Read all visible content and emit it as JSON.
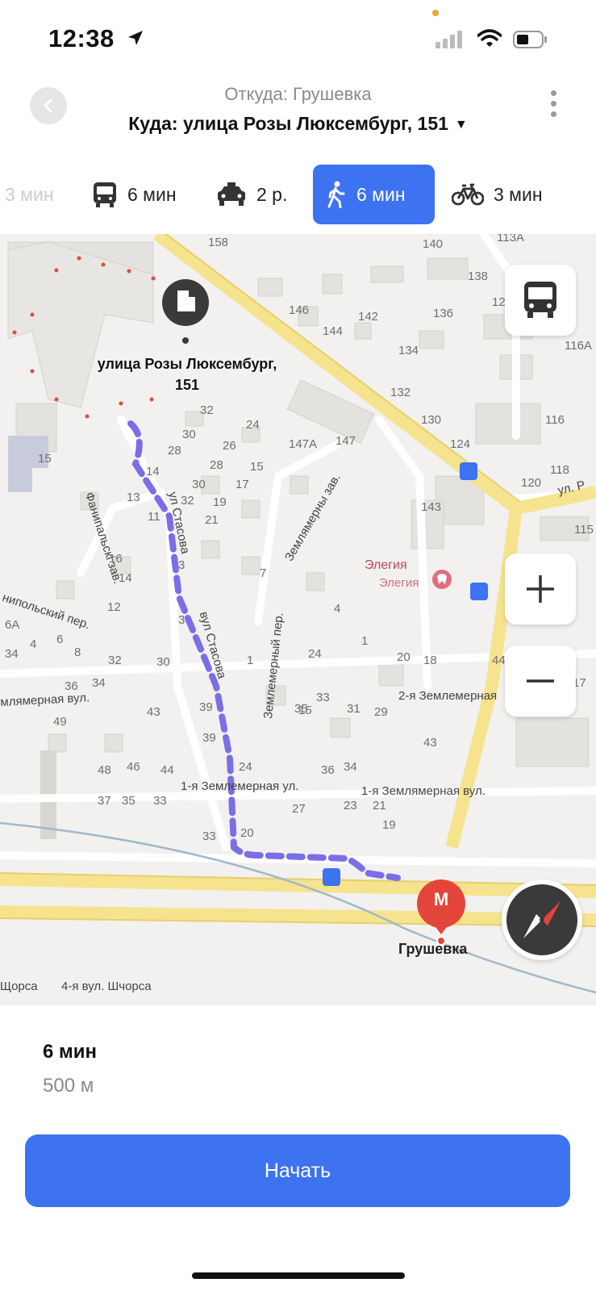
{
  "status_bar": {
    "time": "12:38"
  },
  "header": {
    "from": "Откуда: Грушевка",
    "to": "Куда: улица Розы Люксембург, 151",
    "to_caret": "▼"
  },
  "modes": [
    {
      "icon": "car-icon",
      "label": "3 мин"
    },
    {
      "icon": "bus-icon",
      "label": "6 мин"
    },
    {
      "icon": "taxi-icon",
      "label": "2 р."
    },
    {
      "icon": "walk-icon",
      "label": "6 мин",
      "selected": true
    },
    {
      "icon": "bicycle-icon",
      "label": "3 мин"
    }
  ],
  "map": {
    "destination_label_line1": "улица Розы Люксембург,",
    "destination_label_line2": "151",
    "metro_label": "Грушевка",
    "metro_letter": "M",
    "poi_primary": "Элегия",
    "poi_secondary": "Элегия",
    "streets": {
      "stasova_1": "ул Стасова",
      "stasova_2": "вул Стасова",
      "zemlemerny_per": "Землемерный пер.",
      "zemlemerny_zav": "Землямерны зав.",
      "zemlemernaya_vul": "млямерная вул.",
      "zemlemernaya_2": "2-я Землемерная",
      "zemlemernaya_1": "1-я Землемерная ул.",
      "zemlyamernaya_1": "1-я Землямерная вул.",
      "fanipolsky_per": "нипольский пер.",
      "fanipalsky_zav": "Фанипальскі зав.",
      "ul_r": "ул. Р",
      "shchorsa_4": "4-я вул. Шчорса",
      "shchorsa_left": "Щорса"
    },
    "house_numbers": [
      {
        "t": "158"
      },
      {
        "t": "140"
      },
      {
        "t": "113А"
      },
      {
        "t": "138"
      },
      {
        "t": "12"
      },
      {
        "t": "146"
      },
      {
        "t": "142"
      },
      {
        "t": "136"
      },
      {
        "t": "144"
      },
      {
        "t": "116А"
      },
      {
        "t": "134"
      },
      {
        "t": "132"
      },
      {
        "t": "130"
      },
      {
        "t": "116"
      },
      {
        "t": "124"
      },
      {
        "t": "147А"
      },
      {
        "t": "147"
      },
      {
        "t": "120"
      },
      {
        "t": "118"
      },
      {
        "t": "143"
      },
      {
        "t": "115"
      },
      {
        "t": "32"
      },
      {
        "t": "24"
      },
      {
        "t": "30"
      },
      {
        "t": "28"
      },
      {
        "t": "26"
      },
      {
        "t": "15"
      },
      {
        "t": "28"
      },
      {
        "t": "15"
      },
      {
        "t": "14"
      },
      {
        "t": "30"
      },
      {
        "t": "17"
      },
      {
        "t": "13"
      },
      {
        "t": "32"
      },
      {
        "t": "19"
      },
      {
        "t": "11"
      },
      {
        "t": "21"
      },
      {
        "t": "16"
      },
      {
        "t": "7"
      },
      {
        "t": "14"
      },
      {
        "t": "12"
      },
      {
        "t": "3"
      },
      {
        "t": "3"
      },
      {
        "t": "4"
      },
      {
        "t": "6А"
      },
      {
        "t": "6"
      },
      {
        "t": "1"
      },
      {
        "t": "4"
      },
      {
        "t": "34"
      },
      {
        "t": "8"
      },
      {
        "t": "32"
      },
      {
        "t": "30"
      },
      {
        "t": "1"
      },
      {
        "t": "24"
      },
      {
        "t": "20"
      },
      {
        "t": "18"
      },
      {
        "t": "44"
      },
      {
        "t": "36"
      },
      {
        "t": "34"
      },
      {
        "t": "33"
      },
      {
        "t": "17"
      },
      {
        "t": "15"
      },
      {
        "t": "43"
      },
      {
        "t": "39"
      },
      {
        "t": "35"
      },
      {
        "t": "31"
      },
      {
        "t": "29"
      },
      {
        "t": "49"
      },
      {
        "t": "39"
      },
      {
        "t": "43"
      },
      {
        "t": "48"
      },
      {
        "t": "46"
      },
      {
        "t": "44"
      },
      {
        "t": "24"
      },
      {
        "t": "36"
      },
      {
        "t": "34"
      },
      {
        "t": "37"
      },
      {
        "t": "35"
      },
      {
        "t": "33"
      },
      {
        "t": "27"
      },
      {
        "t": "23"
      },
      {
        "t": "21"
      },
      {
        "t": "19"
      },
      {
        "t": "33"
      },
      {
        "t": "20"
      }
    ]
  },
  "route": {
    "duration": "6 мин",
    "distance": "500 м",
    "start_label": "Начать"
  },
  "colors": {
    "accent": "#3d72f0",
    "route_line": "#7a6fe6",
    "metro": "#e4453a",
    "road_major": "#f6e38e",
    "poi": "#c0455a"
  }
}
